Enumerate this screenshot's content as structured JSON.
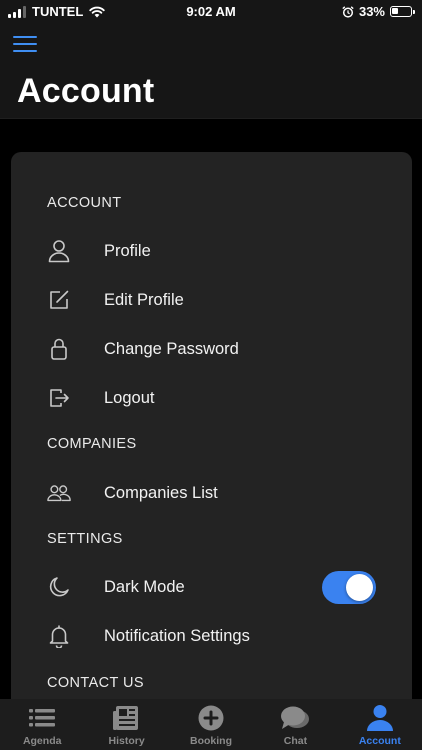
{
  "status_bar": {
    "carrier": "TUNTEL",
    "time": "9:02 AM",
    "battery": "33%",
    "battery_level": 0.33
  },
  "header": {
    "menu_icon": "hamburger-menu-icon",
    "title": "Account"
  },
  "sections": {
    "account": {
      "title": "ACCOUNT",
      "items": [
        {
          "label": "Profile",
          "icon": "user-icon"
        },
        {
          "label": "Edit Profile",
          "icon": "edit-icon"
        },
        {
          "label": "Change Password",
          "icon": "lock-icon"
        },
        {
          "label": "Logout",
          "icon": "logout-icon"
        }
      ]
    },
    "companies": {
      "title": "COMPANIES",
      "items": [
        {
          "label": "Companies List",
          "icon": "users-icon"
        }
      ]
    },
    "settings": {
      "title": "SETTINGS",
      "items": [
        {
          "label": "Dark Mode",
          "icon": "moon-icon",
          "toggle": true
        },
        {
          "label": "Notification Settings",
          "icon": "bell-icon"
        }
      ]
    },
    "contact": {
      "title": "CONTACT US"
    }
  },
  "tabs": [
    {
      "label": "Agenda",
      "icon": "list-icon",
      "active": false
    },
    {
      "label": "History",
      "icon": "newspaper-icon",
      "active": false
    },
    {
      "label": "Booking",
      "icon": "plus-circle-icon",
      "active": false
    },
    {
      "label": "Chat",
      "icon": "chat-bubbles-icon",
      "active": false
    },
    {
      "label": "Account",
      "icon": "person-icon",
      "active": true
    }
  ],
  "colors": {
    "accent": "#3a82f0",
    "card_bg": "#232323",
    "header_bg": "#161616",
    "tab_inactive": "#8a8a8a"
  }
}
